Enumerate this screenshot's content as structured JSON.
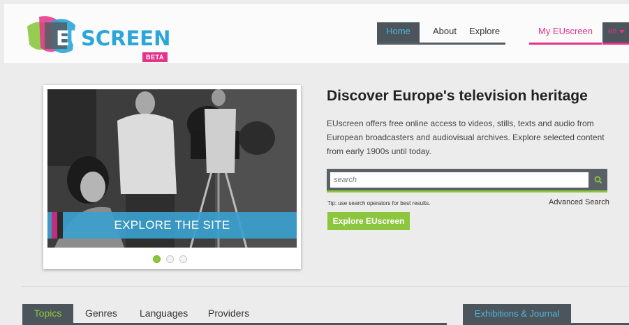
{
  "logo": {
    "eu": "EU",
    "screen": "SCREEN",
    "beta": "BETA"
  },
  "nav": {
    "home": "Home",
    "about": "About",
    "explore": "Explore",
    "my": "My EUscreen",
    "lang": "en"
  },
  "carousel": {
    "banner": "EXPLORE THE SITE",
    "dots": 3,
    "active": 1
  },
  "intro": {
    "title": "Discover Europe's television heritage",
    "text": "EUscreen offers free online access to videos, stills, texts and audio from European broadcasters and audiovisual archives. Explore selected content from early 1900s until today."
  },
  "search": {
    "placeholder": "search",
    "tip": "Tip: use search operators for best results.",
    "advanced": "Advanced Search",
    "button": "Explore EUscreen"
  },
  "tabs": {
    "topics": "Topics",
    "genres": "Genres",
    "languages": "Languages",
    "providers": "Providers"
  },
  "exhibitions": "Exhibitions & Journal",
  "colors": {
    "blue": "#2aa6d8",
    "pink": "#e3338a",
    "green": "#8cc63f",
    "dark": "#4c555b"
  },
  "icons": {
    "search": "search-icon",
    "caret": "chevron-down-icon"
  }
}
